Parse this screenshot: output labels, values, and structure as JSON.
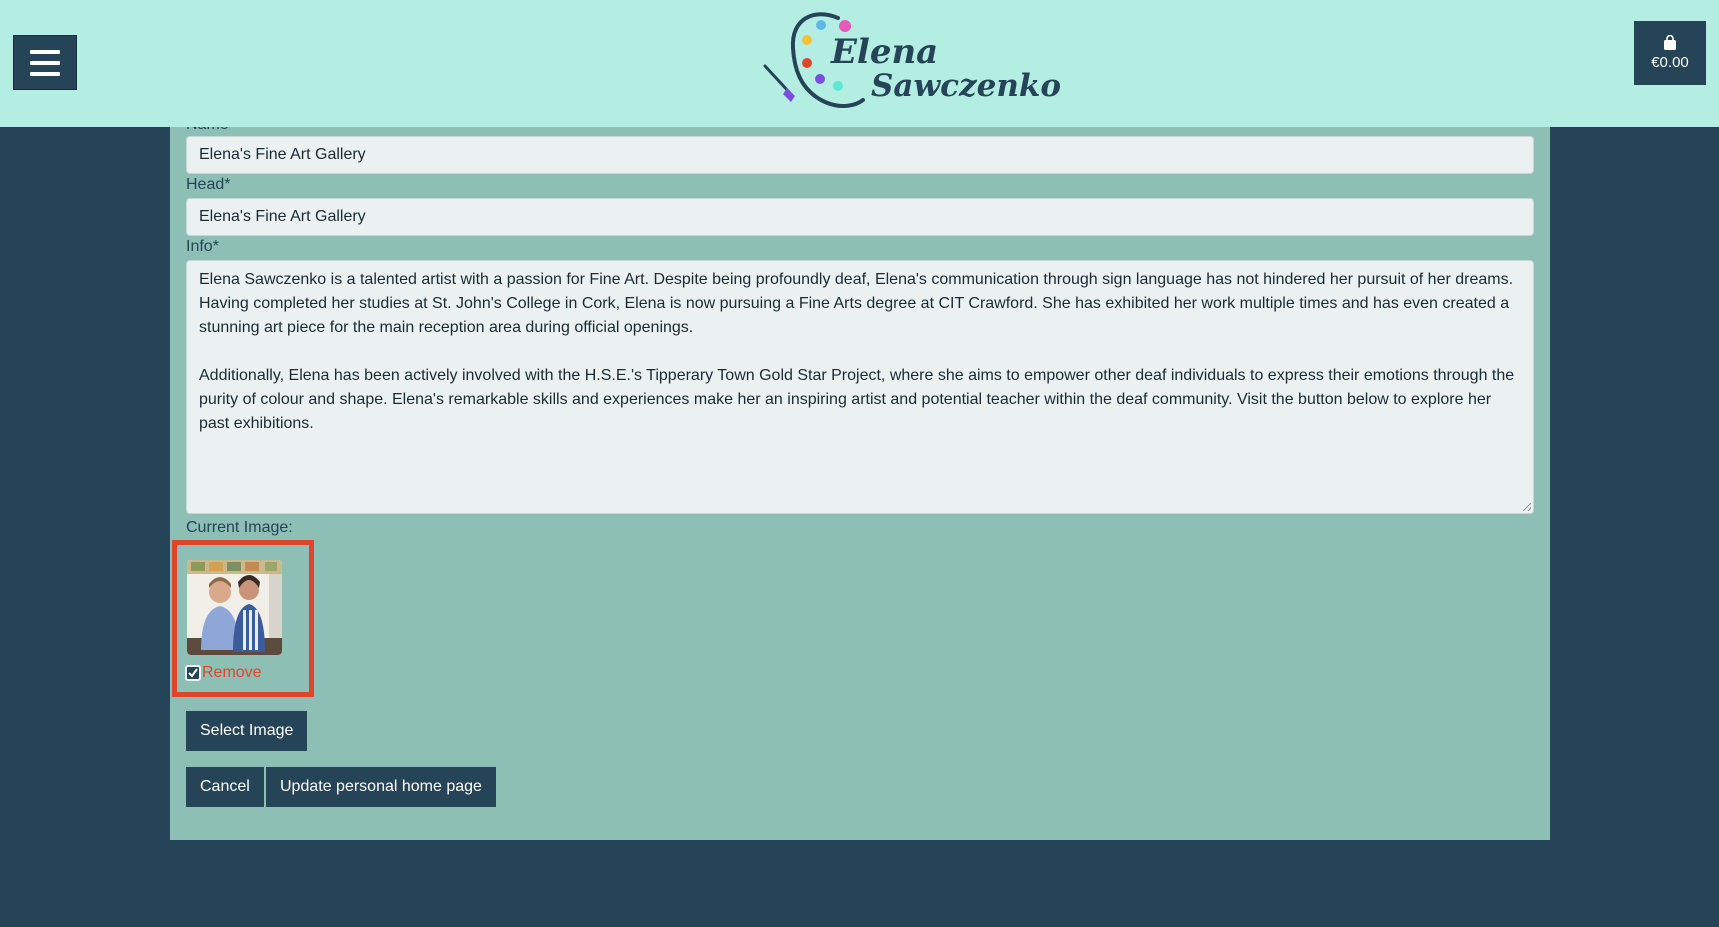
{
  "header": {
    "menu_icon": "hamburger-icon",
    "logo": {
      "first_name": "Elena",
      "last_name": "Sawczenko"
    },
    "cart": {
      "icon": "shopping-bag-icon",
      "total": "€0.00"
    }
  },
  "form": {
    "name_label": "Name*",
    "name_value": "Elena's Fine Art Gallery",
    "head_label": "Head*",
    "head_value": "Elena's Fine Art Gallery",
    "info_label": "Info*",
    "info_paragraphs": [
      "Elena Sawczenko is a talented artist with a passion for Fine Art. Despite being profoundly deaf, Elena's communication through sign language has not hindered her pursuit of her dreams. Having completed her studies at St. John's College in Cork, Elena is now pursuing a Fine Arts degree at CIT Crawford. She has exhibited her work multiple times and has even created a stunning art piece for the main reception area during official openings.",
      "Additionally, Elena has been actively involved with the H.S.E.'s Tipperary Town Gold Star Project, where she aims to empower other deaf individuals to express their emotions through the purity of colour and shape. Elena's remarkable skills and experiences make her an inspiring artist and potential teacher within the deaf community. Visit the button below to explore her past exhibitions."
    ],
    "current_image_label": "Current Image:",
    "remove_checked": true,
    "remove_label": "Remove",
    "select_image_label": "Select Image",
    "cancel_label": "Cancel",
    "update_label": "Update personal home page"
  },
  "colors": {
    "header_bg": "#b4eee2",
    "page_bg": "#264457",
    "panel_bg": "#8ebfb4",
    "accent_dark": "#264457",
    "remove_red": "#e0452b"
  }
}
